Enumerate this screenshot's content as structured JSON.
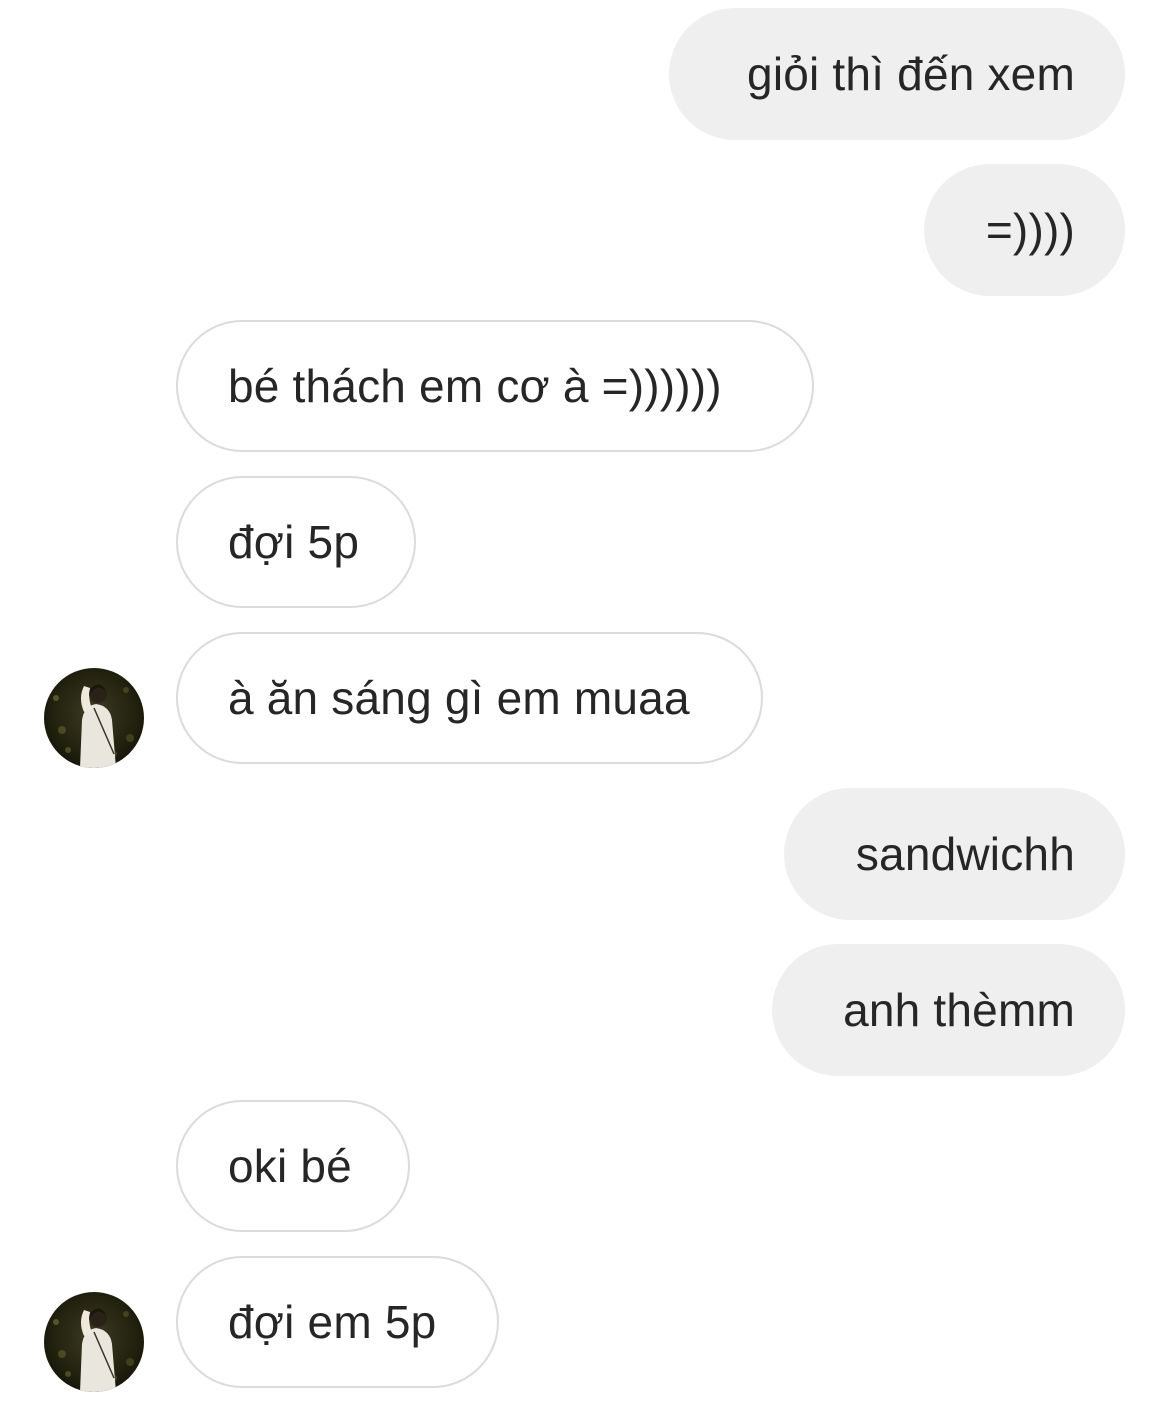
{
  "conversation": {
    "messages": [
      {
        "from": "me",
        "text": "giỏi thì đến xem"
      },
      {
        "from": "me",
        "text": "=))))"
      },
      {
        "from": "them",
        "text": "bé thách em cơ à =))))))"
      },
      {
        "from": "them",
        "text": "đợi 5p"
      },
      {
        "from": "them",
        "text": "à ăn sáng gì em muaa"
      },
      {
        "from": "me",
        "text": "sandwichh"
      },
      {
        "from": "me",
        "text": "anh thèmm"
      },
      {
        "from": "them",
        "text": "oki bé"
      },
      {
        "from": "them",
        "text": "đợi em 5p"
      }
    ]
  },
  "colors": {
    "sent_bubble": "#efefef",
    "received_border": "#dbdbdb",
    "text": "#262626"
  },
  "icons": {
    "contact_avatar": "contact-avatar-photo"
  }
}
